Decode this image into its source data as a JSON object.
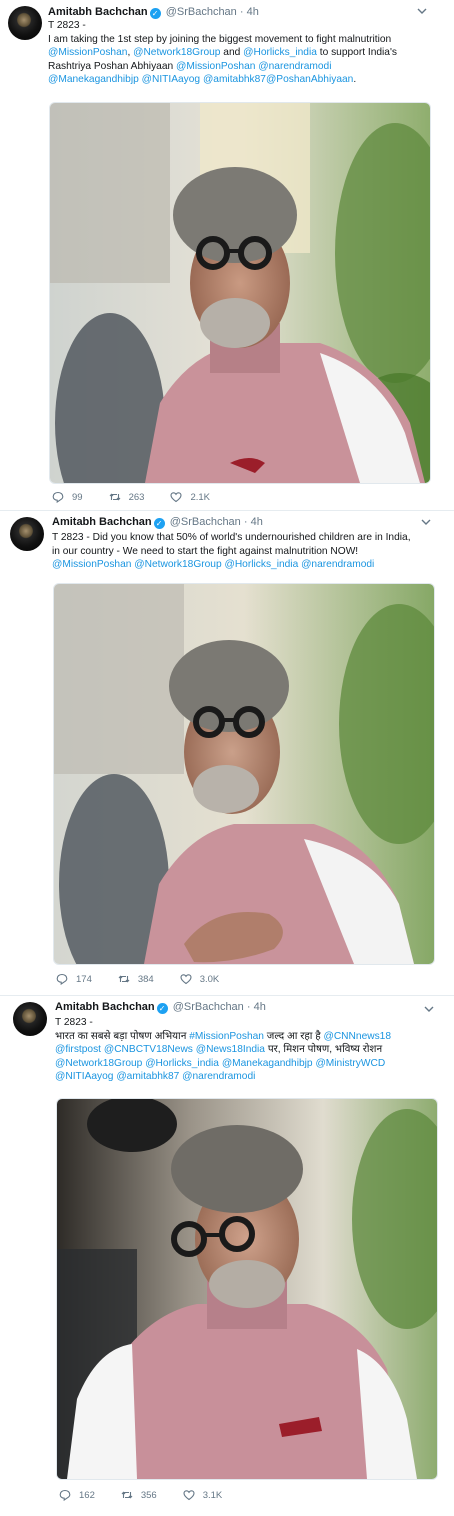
{
  "tweets": [
    {
      "author": {
        "name": "Amitabh Bachchan",
        "handle": "@SrBachchan",
        "separator": "·",
        "time": "4h"
      },
      "line1": "T 2823 -",
      "line2": "I am taking the 1st step by joining the biggest movement to fight malnutrition",
      "l3a": "@MissionPoshan",
      "l3b": ", ",
      "l3c": "@Network18Group",
      "l3d": " and ",
      "l3e": "@Horlicks_india",
      "l3f": " to support India's",
      "l4a": "Rashtriya Poshan Abhiyaan ",
      "l4b": "@MissionPoshan",
      "l4c": " ",
      "l4d": "@narendramodi",
      "l5a": "@Manekagandhibjp",
      "l5b": " ",
      "l5c": "@NITIAayog",
      "l5d": " ",
      "l5e": "@amitabhk87",
      "l5f": "@PoshanAbhiyaan",
      "l5g": ".",
      "replies": "99",
      "retweets": "263",
      "likes": "2.1K"
    },
    {
      "author": {
        "name": "Amitabh Bachchan",
        "handle": "@SrBachchan",
        "separator": "·",
        "time": "4h"
      },
      "line1": "T 2823 -  Did you know that 50% of world's undernourished children are in India,",
      "line2": "in our country - We need to start the fight against malnutrition NOW!",
      "l3a": "@MissionPoshan",
      "l3b": " ",
      "l3c": "@Network18Group",
      "l3d": " ",
      "l3e": "@Horlicks_india",
      "l3f": " ",
      "l3g": "@narendramodi",
      "replies": "174",
      "retweets": "384",
      "likes": "3.0K"
    },
    {
      "author": {
        "name": "Amitabh Bachchan",
        "handle": "@SrBachchan",
        "separator": "·",
        "time": "4h"
      },
      "line1": "T 2823 -",
      "l2a": "भारत का सबसे बड़ा पोषण अभियान  ",
      "l2b": "#MissionPoshan",
      "l2c": " जल्द आ रहा है ",
      "l2d": "@CNNnews18",
      "l3a": "@firstpost",
      "l3b": " ",
      "l3c": "@CNBCTV18News",
      "l3d": " ",
      "l3e": "@News18India",
      "l3f": " पर, मिशन पोषण, भविष्य रोशन",
      "l4a": "@Network18Group",
      "l4b": " ",
      "l4c": "@Horlicks_india",
      "l4d": " ",
      "l4e": "@Manekagandhibjp",
      "l4f": " ",
      "l4g": "@MinistryWCD",
      "l5a": "@NITIAayog",
      "l5b": " ",
      "l5c": "@amitabhk87",
      "l5d": " ",
      "l5e": "@narendramodi",
      "replies": "162",
      "retweets": "356",
      "likes": "3.1K"
    }
  ],
  "colors": {
    "link": "#1b95e0",
    "verified": "#1da1f2",
    "muted": "#657786",
    "text": "#14171a"
  },
  "icons": {
    "verified": "verified-badge-icon",
    "caret": "chevron-down-icon",
    "reply": "reply-icon",
    "retweet": "retweet-icon",
    "like": "heart-icon"
  }
}
